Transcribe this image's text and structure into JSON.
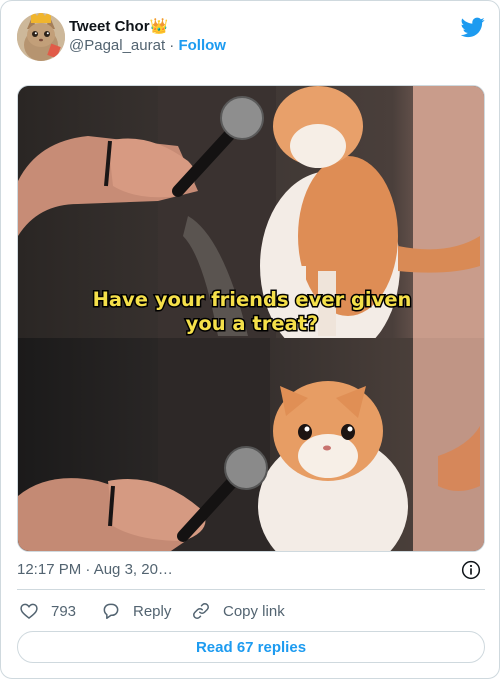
{
  "tweet": {
    "display_name": "Tweet Chor",
    "crown_emoji": "👑",
    "handle": "@Pagal_aurat",
    "separator": "·",
    "follow_label": "Follow"
  },
  "media": {
    "caption_line1": "Have your friends ever given",
    "caption_line2": "you a treat?"
  },
  "meta": {
    "timestamp": "12:17 PM · Aug 3, 20…"
  },
  "actions": {
    "like_count": "793",
    "reply_label": "Reply",
    "copy_label": "Copy link"
  },
  "replies_button": "Read 67 replies",
  "colors": {
    "brand_blue": "#1d9bf0",
    "secondary_text": "#536471",
    "border": "#cfd9de",
    "caption_yellow": "#f5e04a"
  },
  "icons": [
    "twitter-bird-icon",
    "info-icon",
    "heart-icon",
    "reply-bubble-icon",
    "link-icon"
  ]
}
